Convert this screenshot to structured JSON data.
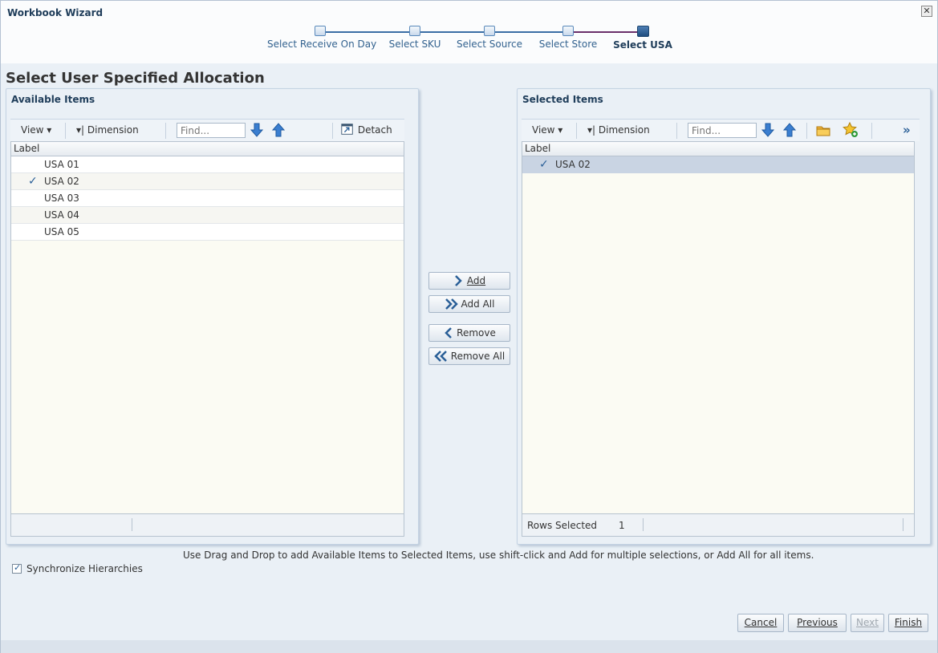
{
  "window": {
    "title": "Workbook Wizard",
    "close_glyph": "✕"
  },
  "train": {
    "stops": [
      {
        "label": "Select Receive On Day"
      },
      {
        "label": "Select SKU"
      },
      {
        "label": "Select Source"
      },
      {
        "label": "Select Store"
      },
      {
        "label": "Select USA"
      }
    ],
    "current": "Select USA"
  },
  "page": {
    "heading": "Select User Specified Allocation"
  },
  "available": {
    "title": "Available Items",
    "toolbar": {
      "view": "View ▾",
      "dimension": "Dimension",
      "find_placeholder": "Find...",
      "detach": "Detach"
    },
    "column": "Label",
    "rows": [
      {
        "check": "",
        "label": "USA 01"
      },
      {
        "check": "✓",
        "label": "USA 02"
      },
      {
        "check": "",
        "label": "USA 03"
      },
      {
        "check": "",
        "label": "USA 04"
      },
      {
        "check": "",
        "label": "USA 05"
      }
    ]
  },
  "selected": {
    "title": "Selected Items",
    "toolbar": {
      "view": "View ▾",
      "dimension": "Dimension",
      "find_placeholder": "Find...",
      "more": "»"
    },
    "column": "Label",
    "rows": [
      {
        "check": "✓",
        "label": "USA 02"
      }
    ],
    "footer": {
      "rows_selected_label": "Rows Selected",
      "rows_selected_value": "1"
    }
  },
  "shuttle": {
    "add": "Add",
    "add_all": "Add All",
    "remove": "Remove",
    "remove_all": "Remove All"
  },
  "hint": "Use Drag and Drop to add Available Items to Selected Items, use shift-click and Add for multiple selections, or Add All for all items.",
  "sync_label": "Synchronize Hierarchies",
  "buttons": {
    "cancel": "Cancel",
    "previous": "Previous",
    "next": "Next",
    "finish": "Finish"
  },
  "colors": {
    "accent": "#1f3d5a",
    "selected_row": "#c9d4e3",
    "train_link": "#33628f"
  },
  "icons": [
    "close-icon",
    "arrow-down-icon",
    "arrow-up-icon",
    "detach-icon",
    "folder-icon",
    "star-add-icon",
    "chevron-right-double-icon",
    "chevron-left-double-icon"
  ]
}
